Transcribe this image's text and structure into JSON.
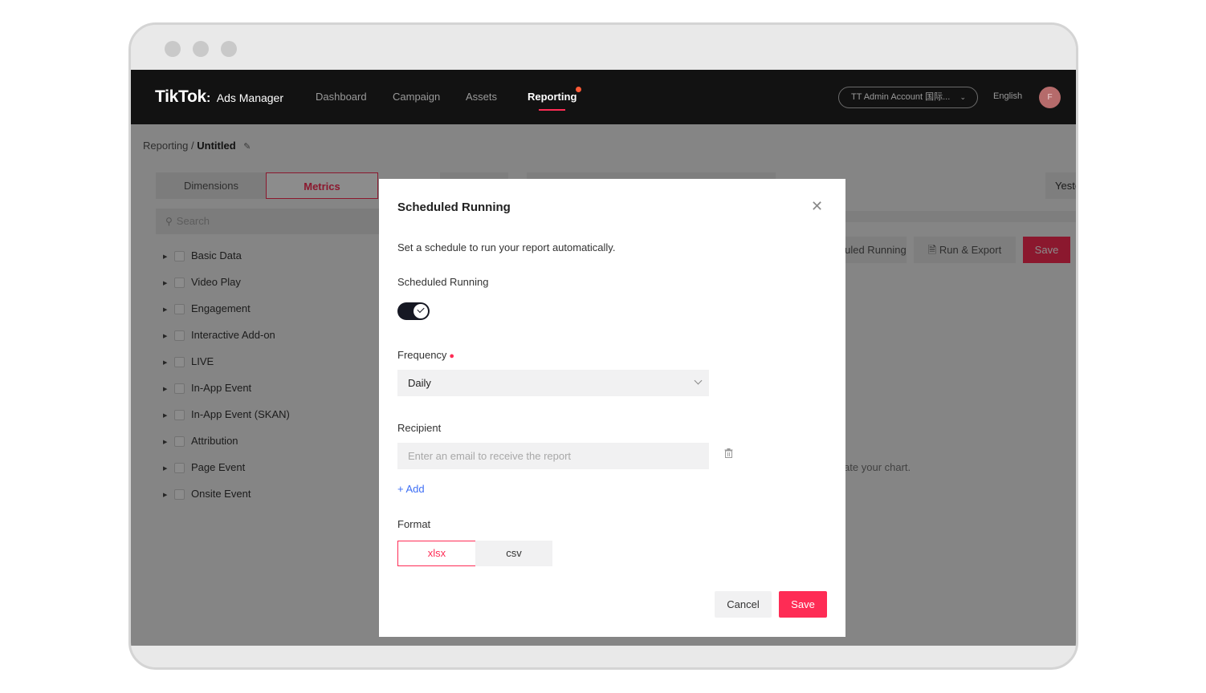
{
  "nav": {
    "brand": "TikTok",
    "product": "Ads Manager",
    "items": [
      {
        "label": "Dashboard",
        "active": false
      },
      {
        "label": "Campaign",
        "active": false
      },
      {
        "label": "Assets",
        "active": false
      },
      {
        "label": "Reporting",
        "active": true
      }
    ],
    "account": "TT Admin Account 国际...",
    "language": "English",
    "avatar_initial": "F"
  },
  "breadcrumb": {
    "root": "Reporting",
    "separator": "/",
    "current": "Untitled"
  },
  "left_panel": {
    "tabs": [
      "Dimensions",
      "Metrics"
    ],
    "active_tab": "Metrics",
    "search_placeholder": "Search",
    "items": [
      "Basic Data",
      "Video Play",
      "Engagement",
      "Interactive Add-on",
      "LIVE",
      "In-App Event",
      "In-App Event (SKAN)",
      "Attribution",
      "Page Event",
      "Onsite Event"
    ]
  },
  "right_panel": {
    "date_label": "Yesterday",
    "scheduled_button": "Scheduled Running",
    "run_export_button": "Run & Export",
    "save_button": "Save",
    "empty_hint": "create your chart."
  },
  "modal": {
    "title": "Scheduled Running",
    "description": "Set a schedule to run your report automatically.",
    "toggle_label": "Scheduled Running",
    "toggle_on": true,
    "frequency_label": "Frequency",
    "frequency_value": "Daily",
    "recipient_label": "Recipient",
    "recipient_placeholder": "Enter an email to receive the report",
    "add_label": "Add",
    "format_label": "Format",
    "formats": [
      "xlsx",
      "csv"
    ],
    "selected_format": "xlsx",
    "cancel_label": "Cancel",
    "save_label": "Save"
  },
  "colors": {
    "accent": "#fe2c55",
    "link": "#3e6ff5",
    "nav_bg": "#121212"
  }
}
